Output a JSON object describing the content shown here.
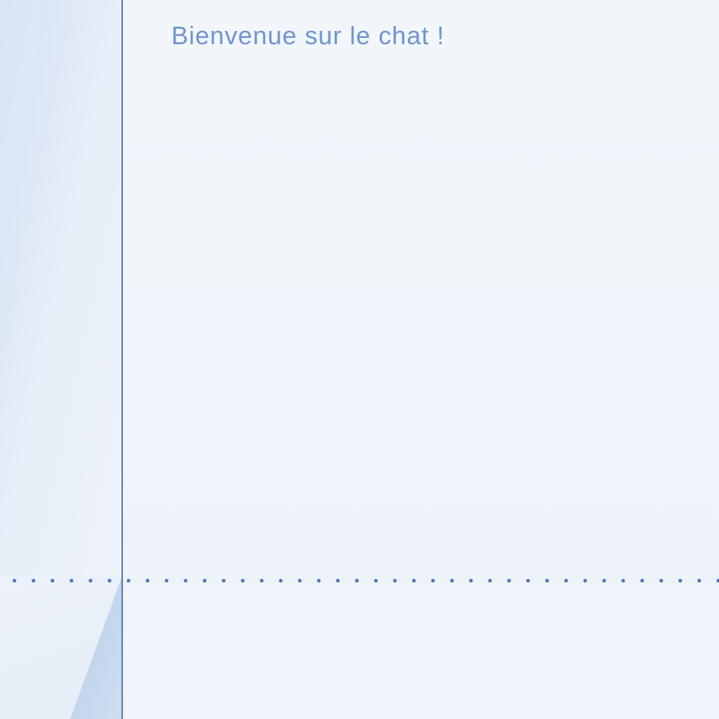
{
  "chat": {
    "welcome_message": "Bienvenue sur le chat !"
  },
  "colors": {
    "accent": "#4f76b4",
    "welcome_text": "#6f95cf",
    "background": "#eef3fa"
  }
}
